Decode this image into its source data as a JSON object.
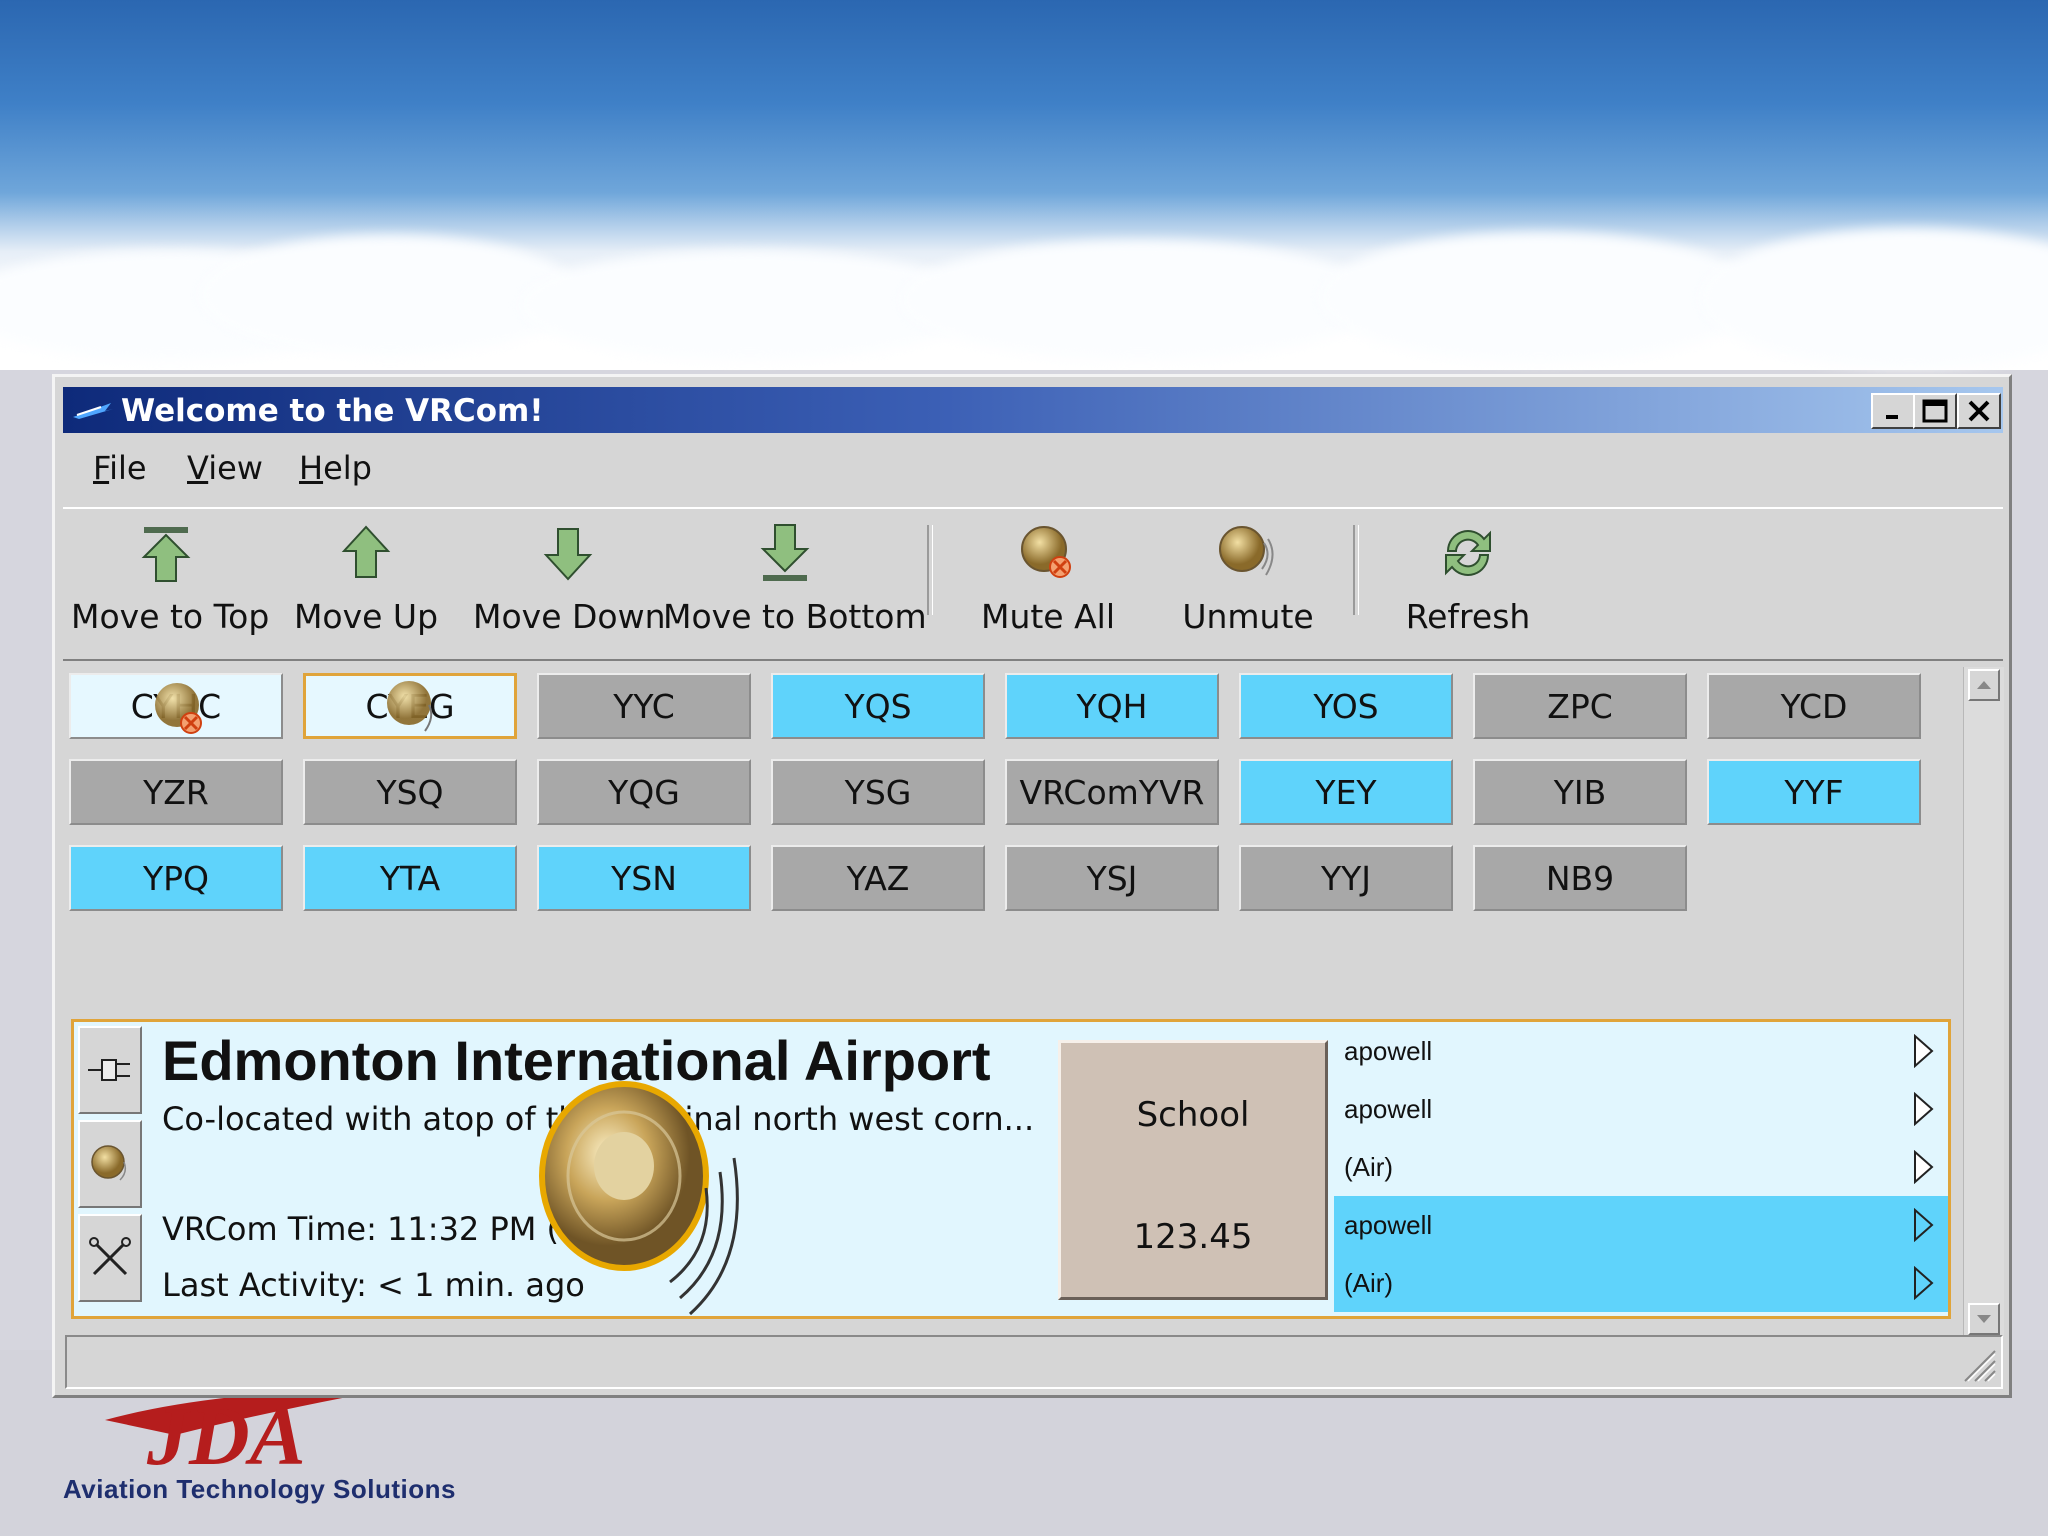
{
  "window": {
    "title": "Welcome to the VRCom!"
  },
  "menu": [
    {
      "first": "F",
      "rest": "ile"
    },
    {
      "first": "V",
      "rest": "iew"
    },
    {
      "first": "H",
      "rest": "elp"
    }
  ],
  "toolbar": {
    "move_top": "Move to Top",
    "move_up": "Move Up",
    "move_down": "Move Down",
    "move_bottom": "Move to Bottom",
    "mute_all": "Mute All",
    "unmute": "Unmute",
    "refresh": "Refresh"
  },
  "channels": [
    {
      "label": "CYHC",
      "style": "light"
    },
    {
      "label": "CYEG",
      "style": "light-selected"
    },
    {
      "label": "YYC",
      "style": "gray"
    },
    {
      "label": "YQS",
      "style": "cyan"
    },
    {
      "label": "YQH",
      "style": "cyan"
    },
    {
      "label": "YOS",
      "style": "cyan"
    },
    {
      "label": "ZPC",
      "style": "gray"
    },
    {
      "label": "YCD",
      "style": "gray"
    },
    {
      "label": "YZR",
      "style": "gray"
    },
    {
      "label": "YSQ",
      "style": "gray"
    },
    {
      "label": "YQG",
      "style": "gray"
    },
    {
      "label": "YSG",
      "style": "gray"
    },
    {
      "label": "VRComYVR",
      "style": "gray"
    },
    {
      "label": "YEY",
      "style": "cyan"
    },
    {
      "label": "YIB",
      "style": "gray"
    },
    {
      "label": "YYF",
      "style": "cyan"
    },
    {
      "label": "YPQ",
      "style": "cyan"
    },
    {
      "label": "YTA",
      "style": "cyan"
    },
    {
      "label": "YSN",
      "style": "cyan"
    },
    {
      "label": "YAZ",
      "style": "gray"
    },
    {
      "label": "YSJ",
      "style": "gray"
    },
    {
      "label": "YYJ",
      "style": "gray"
    },
    {
      "label": "NB9",
      "style": "gray"
    }
  ],
  "detail": {
    "airport": "Edmonton International Airport",
    "description": "Co-located with atop of the terminal north west corn...",
    "vrcom_time": "VRCom Time: 11:32 PM (MST)",
    "last_activity": "Last Activity: < 1 min. ago",
    "position": "School",
    "frequency": "123.45",
    "users": [
      {
        "name": "apowell",
        "style": "a"
      },
      {
        "name": "apowell",
        "style": "a"
      },
      {
        "name": "(Air)",
        "style": "a"
      },
      {
        "name": "apowell",
        "style": "b"
      },
      {
        "name": "(Air)",
        "style": "b"
      }
    ]
  },
  "brand": {
    "tagline": "Aviation Technology Solutions",
    "logo_text": "JDA"
  },
  "colors": {
    "cyan": "#5fd3fb",
    "gray": "#a8a8a8",
    "light": "#e6f8ff",
    "accent": "#e0a43a",
    "title_dark": "#0e2a7a"
  }
}
